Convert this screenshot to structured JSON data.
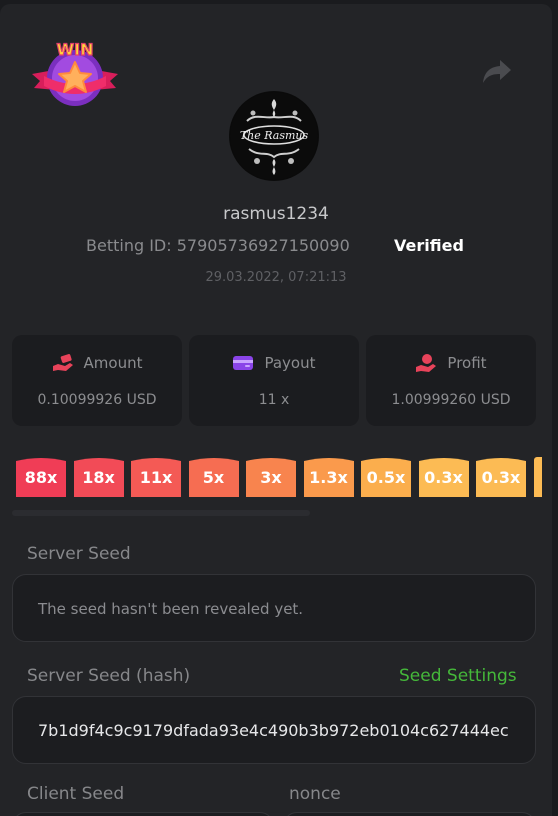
{
  "badge": {
    "text": "WIN"
  },
  "player": {
    "username": "rasmus1234",
    "avatar_text": "The Rasmus",
    "betting_id_label": "Betting ID:",
    "betting_id": "57905736927150090",
    "verified_label": "Verified",
    "timestamp": "29.03.2022, 07:21:13"
  },
  "stats": [
    {
      "label": "Amount",
      "value": "0.10099926 USD",
      "icon": "money-hand-icon",
      "color": "#e8435a"
    },
    {
      "label": "Payout",
      "value": "11 x",
      "icon": "wallet-icon",
      "color": "#8a44e8"
    },
    {
      "label": "Profit",
      "value": "1.00999260 USD",
      "icon": "coin-hand-icon",
      "color": "#e8435a"
    }
  ],
  "multipliers": [
    {
      "label": "88x",
      "color": "#f03d56"
    },
    {
      "label": "18x",
      "color": "#f24b57"
    },
    {
      "label": "11x",
      "color": "#f45a55"
    },
    {
      "label": "5x",
      "color": "#f66d52"
    },
    {
      "label": "3x",
      "color": "#f8844e"
    },
    {
      "label": "1.3x",
      "color": "#fa9a4c"
    },
    {
      "label": "0.5x",
      "color": "#fbae4d"
    },
    {
      "label": "0.3x",
      "color": "#fcbb54"
    },
    {
      "label": "0.3x",
      "color": "#fcbb54"
    }
  ],
  "server_seed": {
    "label": "Server Seed",
    "value": "The seed hasn't been revealed yet."
  },
  "server_seed_hash": {
    "label": "Server Seed (hash)",
    "link": "Seed Settings",
    "value": "7b1d9f4c9c9179dfada93e4c490b3b972eb0104c627444ec"
  },
  "client_seed": {
    "label": "Client Seed"
  },
  "nonce": {
    "label": "nonce"
  },
  "colors": {
    "background": "#1a1b1e",
    "panel": "#232427",
    "link": "#45b83a",
    "verified": "#ffffff"
  }
}
